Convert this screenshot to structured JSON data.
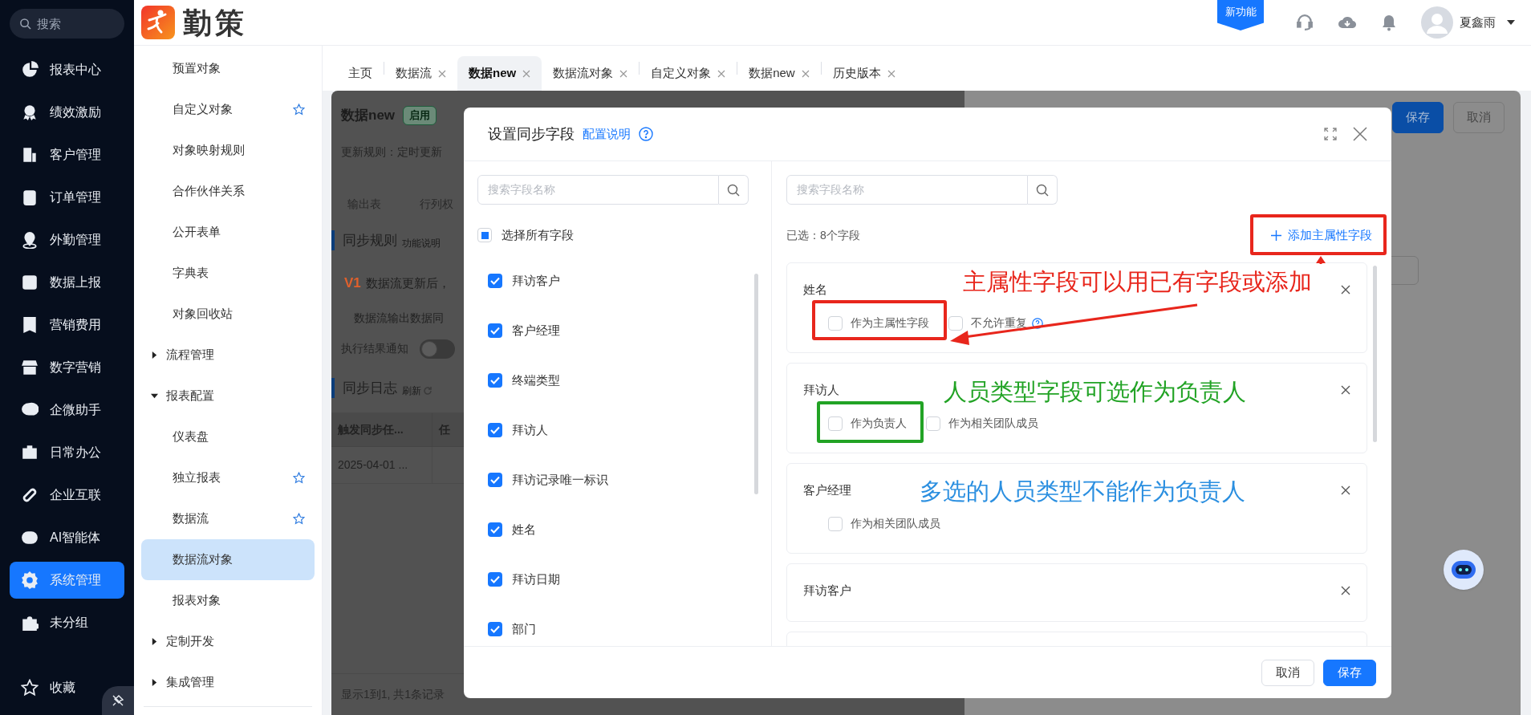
{
  "nav": {
    "search_placeholder": "搜索",
    "items": [
      {
        "label": "报表中心",
        "selected": false
      },
      {
        "label": "绩效激励",
        "selected": false
      },
      {
        "label": "客户管理",
        "selected": false
      },
      {
        "label": "订单管理",
        "selected": false
      },
      {
        "label": "外勤管理",
        "selected": false
      },
      {
        "label": "数据上报",
        "selected": false
      },
      {
        "label": "营销费用",
        "selected": false
      },
      {
        "label": "数字营销",
        "selected": false
      },
      {
        "label": "企微助手",
        "selected": false
      },
      {
        "label": "日常办公",
        "selected": false
      },
      {
        "label": "企业互联",
        "selected": false
      },
      {
        "label": "AI智能体",
        "selected": false
      },
      {
        "label": "系统管理",
        "selected": true
      },
      {
        "label": "未分组",
        "selected": false
      }
    ],
    "favorites": "收藏"
  },
  "brand": "勤策",
  "topbar": {
    "new_feature_badge": "新功能",
    "user": "夏鑫雨"
  },
  "subnav": [
    {
      "kind": "item",
      "label": "预置对象",
      "starred": false,
      "selected": false
    },
    {
      "kind": "item",
      "label": "自定义对象",
      "starred": true,
      "selected": false
    },
    {
      "kind": "item",
      "label": "对象映射规则",
      "starred": false,
      "selected": false
    },
    {
      "kind": "item",
      "label": "合作伙伴关系",
      "starred": false,
      "selected": false
    },
    {
      "kind": "item",
      "label": "公开表单",
      "starred": false,
      "selected": false
    },
    {
      "kind": "item",
      "label": "字典表",
      "starred": false,
      "selected": false
    },
    {
      "kind": "item",
      "label": "对象回收站",
      "starred": false,
      "selected": false
    },
    {
      "kind": "group",
      "label": "流程管理",
      "expanded": false
    },
    {
      "kind": "group",
      "label": "报表配置",
      "expanded": true
    },
    {
      "kind": "item",
      "label": "仪表盘",
      "starred": false,
      "selected": false
    },
    {
      "kind": "item",
      "label": "独立报表",
      "starred": true,
      "selected": false
    },
    {
      "kind": "item",
      "label": "数据流",
      "starred": true,
      "selected": false
    },
    {
      "kind": "item",
      "label": "数据流对象",
      "starred": false,
      "selected": true
    },
    {
      "kind": "item",
      "label": "报表对象",
      "starred": false,
      "selected": false
    },
    {
      "kind": "group",
      "label": "定制开发",
      "expanded": false
    },
    {
      "kind": "group",
      "label": "集成管理",
      "expanded": false
    }
  ],
  "tabs": [
    {
      "label": "主页",
      "selected": false,
      "closable": false
    },
    {
      "label": "数据流",
      "selected": false,
      "closable": true
    },
    {
      "label": "数据new",
      "selected": true,
      "closable": true
    },
    {
      "label": "数据流对象",
      "selected": false,
      "closable": true
    },
    {
      "label": "自定义对象",
      "selected": false,
      "closable": true
    },
    {
      "label": "数据new",
      "selected": false,
      "closable": true
    },
    {
      "label": "历史版本",
      "selected": false,
      "closable": true
    }
  ],
  "page": {
    "title": "数据new",
    "status": "启用",
    "update_rule": "更新规则：定时更新",
    "tabs": [
      "输出表",
      "行列权"
    ],
    "sync_rule": {
      "heading": "同步规则",
      "help": "功能说明",
      "version": "V1",
      "text": "数据流更新后，",
      "note": "数据流输出数据同"
    },
    "notify": {
      "label": "执行结果通知",
      "on": false
    },
    "log": {
      "heading": "同步日志",
      "refresh": "刷新"
    },
    "table": {
      "columns": [
        "触发同步任...",
        "任"
      ],
      "rows": [
        [
          "2025-04-01 ...",
          ""
        ]
      ]
    },
    "footer": "显示1到1, 共1条记录"
  },
  "drawer": {
    "buttons": [
      {
        "label": "保存",
        "kind": "primary"
      },
      {
        "label": "取消",
        "kind": "default"
      }
    ]
  },
  "modal": {
    "title": "设置同步字段",
    "help_link": "配置说明",
    "left": {
      "search_placeholder": "搜索字段名称",
      "select_all": {
        "label": "选择所有字段",
        "indeterminate": true
      },
      "fields": [
        {
          "label": "拜访客户",
          "checked": true
        },
        {
          "label": "客户经理",
          "checked": true
        },
        {
          "label": "终端类型",
          "checked": true
        },
        {
          "label": "拜访人",
          "checked": true
        },
        {
          "label": "拜访记录唯一标识",
          "checked": true
        },
        {
          "label": "姓名",
          "checked": true
        },
        {
          "label": "拜访日期",
          "checked": true
        },
        {
          "label": "部门",
          "checked": true
        }
      ]
    },
    "right": {
      "search_placeholder": "搜索字段名称",
      "selected_count": "已选：8个字段",
      "add_link": "添加主属性字段",
      "cards": [
        {
          "title": "姓名",
          "options": [
            {
              "label": "作为主属性字段",
              "checked": false,
              "help": false
            },
            {
              "label": "不允许重复",
              "checked": false,
              "help": true
            }
          ]
        },
        {
          "title": "拜访人",
          "options": [
            {
              "label": "作为负责人",
              "checked": false,
              "help": false
            },
            {
              "label": "作为相关团队成员",
              "checked": false,
              "help": false
            }
          ]
        },
        {
          "title": "客户经理",
          "options": [
            {
              "label": "作为相关团队成员",
              "checked": false,
              "help": false
            }
          ]
        },
        {
          "title": "拜访客户"
        }
      ]
    },
    "buttons": [
      {
        "label": "取消",
        "kind": "default"
      },
      {
        "label": "保存",
        "kind": "primary"
      }
    ]
  },
  "annotations": [
    {
      "text": "主属性字段可以用已有字段或添加",
      "color": "#e8261c"
    },
    {
      "text": "人员类型字段可选作为负责人",
      "color": "#22a325"
    },
    {
      "text": "多选的人员类型不能作为负责人",
      "color": "#2b8fe0"
    }
  ]
}
